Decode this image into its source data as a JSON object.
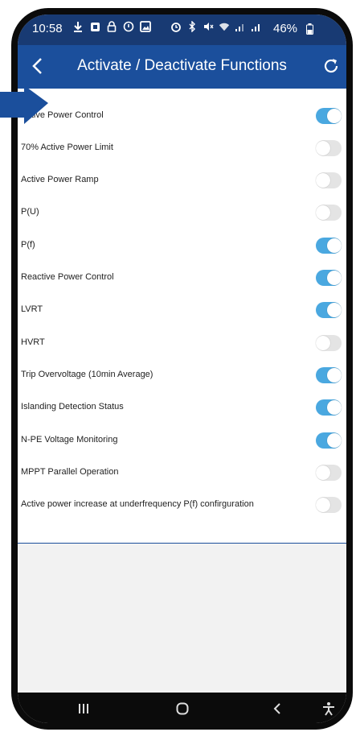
{
  "status_bar": {
    "time": "10:58",
    "battery": "46%",
    "left_icons": [
      "download-icon",
      "notification-icon",
      "lock-icon",
      "sync-icon",
      "image-icon"
    ],
    "right_icons": [
      "alarm-icon",
      "bluetooth-icon",
      "mute-icon",
      "wifi-icon",
      "signal-icon",
      "signal-icon",
      "battery-icon"
    ]
  },
  "header": {
    "title": "Activate / Deactivate Functions",
    "back_icon": "chevron-left-icon",
    "refresh_icon": "refresh-icon"
  },
  "functions": [
    {
      "label": "Active Power Control",
      "enabled": true
    },
    {
      "label": "70% Active Power Limit",
      "enabled": false
    },
    {
      "label": "Active Power Ramp",
      "enabled": false
    },
    {
      "label": "P(U)",
      "enabled": false
    },
    {
      "label": "P(f)",
      "enabled": true
    },
    {
      "label": "Reactive Power Control",
      "enabled": true
    },
    {
      "label": "LVRT",
      "enabled": true
    },
    {
      "label": "HVRT",
      "enabled": false
    },
    {
      "label": "Trip Overvoltage (10min Average)",
      "enabled": true
    },
    {
      "label": "Islanding Detection Status",
      "enabled": true
    },
    {
      "label": "N-PE Voltage Monitoring",
      "enabled": true
    },
    {
      "label": "MPPT Parallel Operation",
      "enabled": false
    },
    {
      "label": "Active power increase at underfrequency P(f) confirguration",
      "enabled": false
    }
  ],
  "nav": {
    "recent_icon": "recent-apps-icon",
    "home_icon": "home-icon",
    "back_icon": "back-icon",
    "accessibility_icon": "accessibility-icon"
  },
  "colors": {
    "header": "#1b4f9c",
    "status_bar": "#183a73",
    "toggle_on": "#4aa8e0",
    "toggle_off": "#e4e4e4",
    "pointer": "#1b4f9c"
  }
}
